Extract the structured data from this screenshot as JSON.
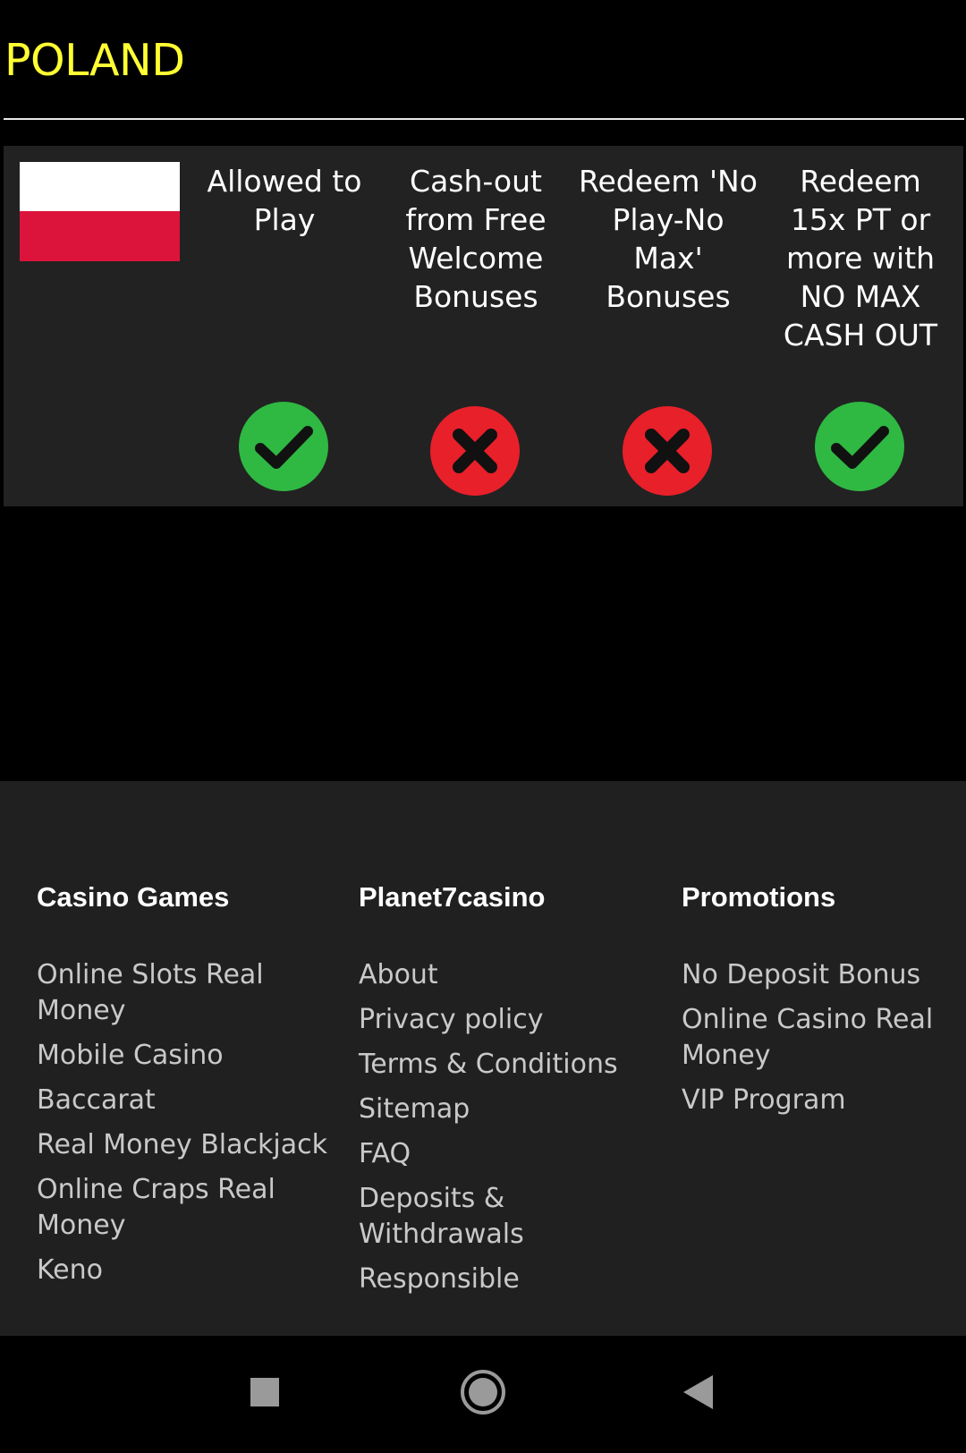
{
  "country": {
    "name": "POLAND",
    "title_color": "#ffff33"
  },
  "status_table": {
    "columns": [
      {
        "label": "Allowed to Play",
        "status": "allowed"
      },
      {
        "label": "Cash-out from Free Welcome Bonuses",
        "status": "denied"
      },
      {
        "label": "Redeem 'No Play-No Max' Bonuses",
        "status": "denied"
      },
      {
        "label": "Redeem 15x PT or more with NO MAX CASH OUT",
        "status": "allowed"
      }
    ],
    "colors": {
      "allowed": "#2fb842",
      "denied": "#e8202a",
      "flag_white": "#ffffff",
      "flag_red": "#dc143c"
    }
  },
  "footer": {
    "columns": [
      {
        "heading": "Casino Games",
        "links": [
          "Online Slots Real Money",
          "Mobile Casino",
          "Baccarat",
          "Real Money Blackjack",
          "Online Craps Real Money",
          "Keno"
        ]
      },
      {
        "heading": "Planet7casino",
        "links": [
          "About",
          "Privacy policy",
          "Terms & Conditions",
          "Sitemap",
          "FAQ",
          "Deposits & Withdrawals",
          "Responsible"
        ]
      },
      {
        "heading": "Promotions",
        "links": [
          "No Deposit Bonus",
          "Online Casino Real Money",
          "VIP Program"
        ]
      }
    ]
  },
  "nav_bar": {
    "buttons": [
      "recents-icon",
      "home-icon",
      "back-icon"
    ]
  }
}
